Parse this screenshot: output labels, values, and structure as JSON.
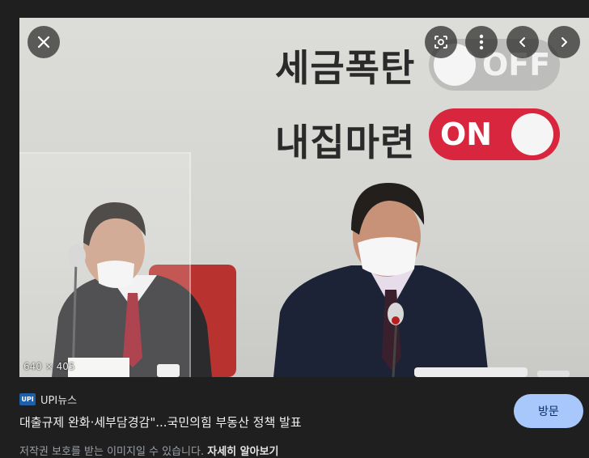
{
  "image": {
    "dimensions": "640 × 405",
    "slogan_line1": "세금폭탄",
    "slogan_line2": "내집마련",
    "toggle_off": "OFF",
    "toggle_on": "ON"
  },
  "controls": {
    "close": "close-icon",
    "lens": "lens-icon",
    "more": "more-vert-icon",
    "prev": "chevron-left-icon",
    "next": "chevron-right-icon"
  },
  "result": {
    "source_logo": "UPI",
    "source_name": "UPI뉴스",
    "title": "대출규제 완화·세부담경감\"...국민의힘 부동산 정책 발표",
    "visit_label": "방문",
    "description": "저작권 보호를 받는 이미지일 수 있습니다.",
    "description_link": "자세히 알아보기"
  },
  "colors": {
    "background": "#1f1f1f",
    "visit_button": "#a8c7fa",
    "toggle_on": "#d7263d"
  }
}
